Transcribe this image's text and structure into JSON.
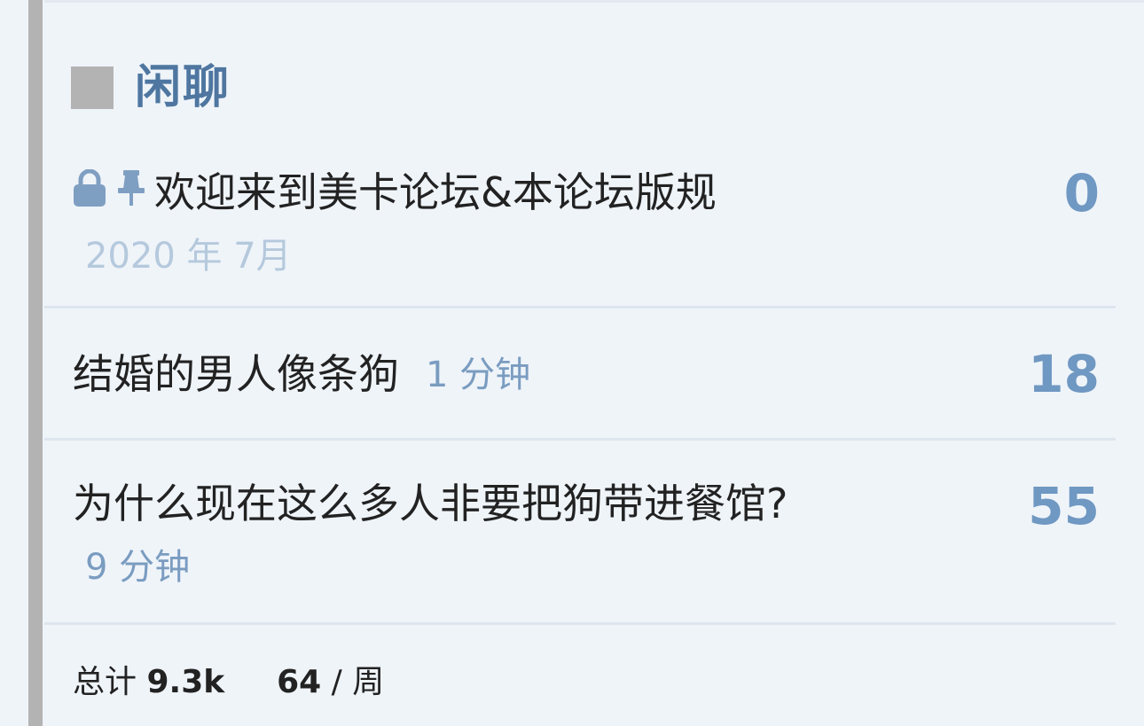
{
  "category": {
    "name": "闲聊",
    "swatch_color": "#b3b3b3",
    "title_color": "#4e76a0"
  },
  "topics": [
    {
      "title": "欢迎来到美卡论坛&本论坛版规",
      "age": "2020 年 7月",
      "replies": "0",
      "locked": true,
      "pinned": true
    },
    {
      "title": "结婚的男人像条狗",
      "age": "1 分钟",
      "replies": "18"
    },
    {
      "title": "为什么现在这么多人非要把狗带进餐馆?",
      "age": "9 分钟",
      "replies": "55"
    }
  ],
  "footer": {
    "total_label": "总计",
    "total_value": "9.3k",
    "weekly_value": "64",
    "weekly_label": "/ 周"
  },
  "icons": {
    "lock": "lock-icon",
    "pin": "pin-icon"
  },
  "colors": {
    "background": "#eff4f9",
    "sidebar_stripe": "#b3b3b3",
    "count_blue": "#6f98c2",
    "age_blue": "#7a9cc0",
    "age_faded": "#b5c9dd"
  }
}
